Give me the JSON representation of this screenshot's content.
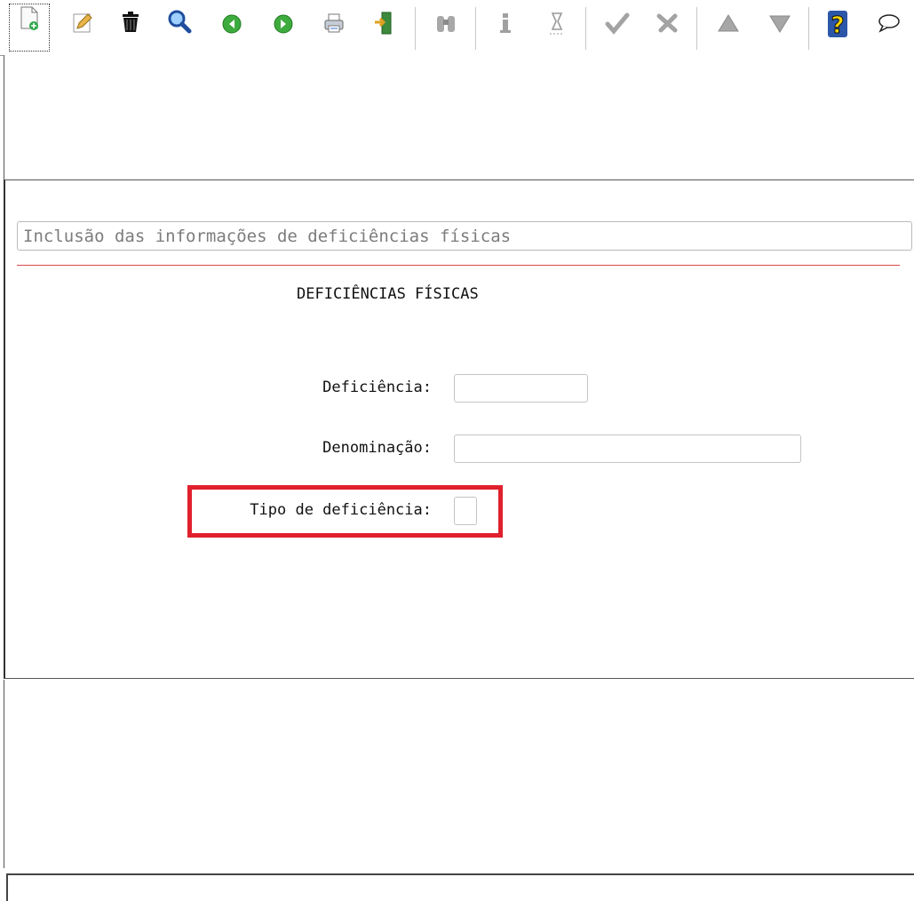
{
  "toolbar": {
    "icons": [
      "new-document-icon",
      "edit-pencil-icon",
      "trash-icon",
      "search-magnifier-icon",
      "previous-green-icon",
      "next-green-icon",
      "print-icon",
      "exit-door-icon",
      "binoculars-icon",
      "info-icon",
      "hourglass-icon",
      "confirm-check-icon",
      "cancel-x-icon",
      "up-triangle-icon",
      "down-triangle-icon",
      "help-question-icon",
      "chat-bubble-icon"
    ]
  },
  "form": {
    "description": "Inclusão das informações de deficiências físicas",
    "section_title": "DEFICIÊNCIAS FÍSICAS",
    "fields": {
      "deficiencia_label": "Deficiência:",
      "deficiencia_value": "",
      "denominacao_label": "Denominação:",
      "denominacao_value": "",
      "tipo_label": "Tipo de deficiência:",
      "tipo_value": ""
    }
  },
  "colors": {
    "highlight": "#e0202c",
    "separator_line": "#d94848"
  }
}
